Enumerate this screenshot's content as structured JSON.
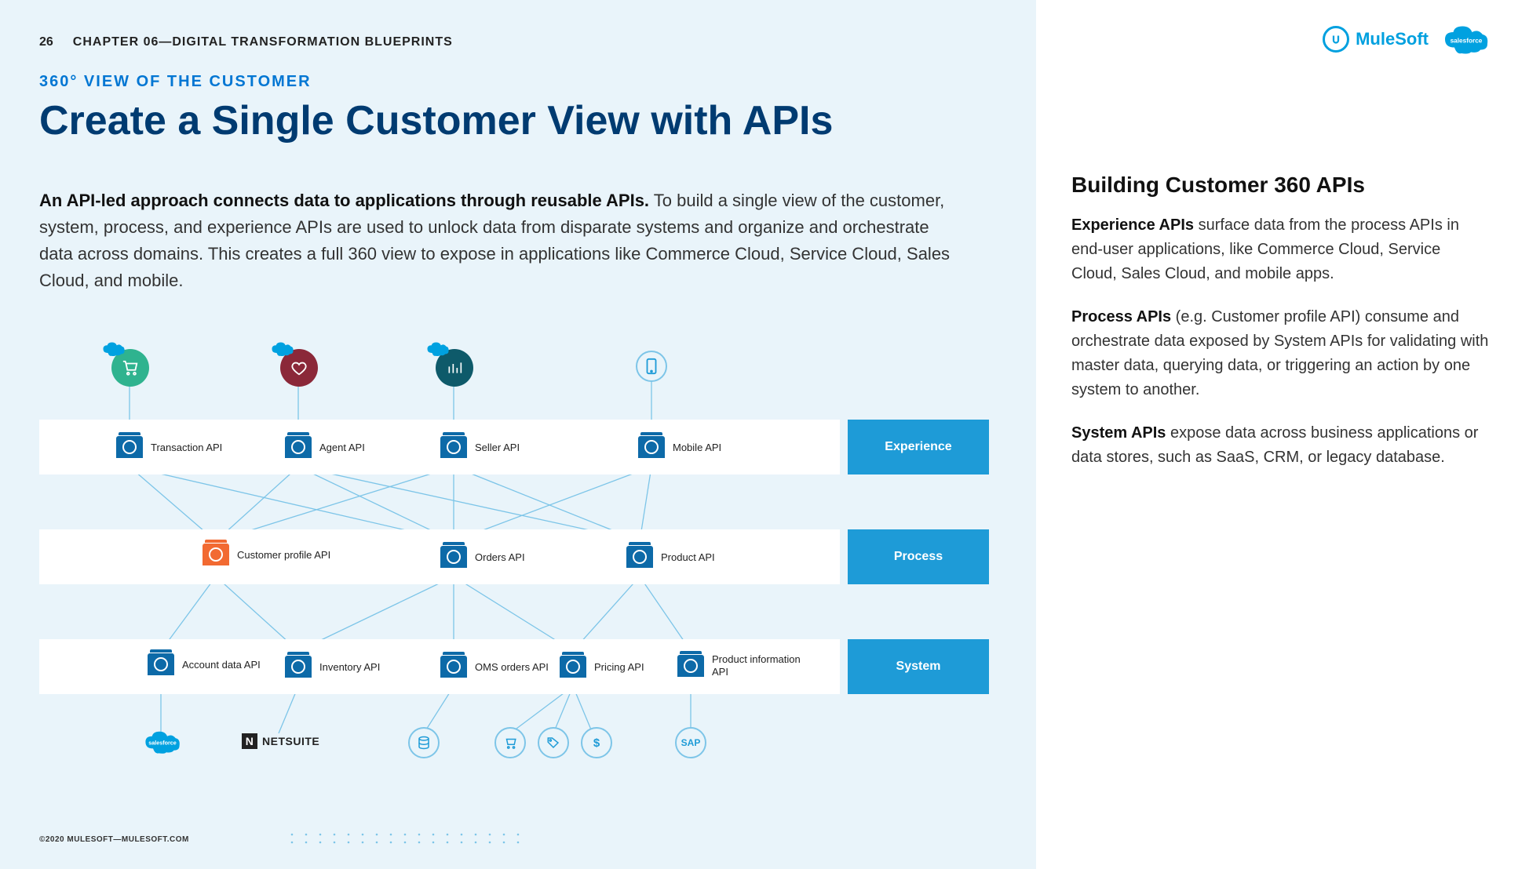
{
  "page_number": "26",
  "chapter_label": "CHAPTER 06—DIGITAL TRANSFORMATION BLUEPRINTS",
  "eyebrow": "360° VIEW OF THE CUSTOMER",
  "title": "Create a Single Customer View with APIs",
  "intro_bold": "An API-led approach connects data to applications through reusable APIs.",
  "intro_rest": " To build a single view of the customer, system, process, and experience APIs are used to unlock data from disparate systems and organize and orchestrate data across domains. This creates a full 360 view to expose in applications like Commerce Cloud, Service Cloud, Sales Cloud, and mobile.",
  "layers": {
    "experience": "Experience",
    "process": "Process",
    "system": "System"
  },
  "experience_apis": [
    "Transaction API",
    "Agent API",
    "Seller API",
    "Mobile API"
  ],
  "process_apis": [
    "Customer profile API",
    "Orders API",
    "Product API"
  ],
  "system_apis": [
    "Account data  API",
    "Inventory API",
    "OMS orders API",
    "Pricing API",
    "Product information API"
  ],
  "bottom_systems": {
    "salesforce": "salesforce",
    "netsuite": "NETSUITE",
    "sap": "SAP"
  },
  "top_clouds": {
    "commerce": "salesforce",
    "service": "salesforce",
    "sales": "salesforce"
  },
  "right": {
    "mulesoft": "MuleSoft",
    "sf": "salesforce",
    "heading": "Building Customer 360 APIs",
    "p1_bold": "Experience APIs",
    "p1_rest": " surface data from the process APIs in end-user applications, like Commerce Cloud, Service Cloud, Sales Cloud, and mobile apps.",
    "p2_bold": "Process APIs",
    "p2_rest": " (e.g. Customer profile API) consume and orchestrate data exposed by System APIs for validating with master data, querying data, or triggering an action by one system to another.",
    "p3_bold": "System APIs",
    "p3_rest": " expose data across business applications or data stores, such as SaaS, CRM, or legacy database."
  },
  "footer": "©2020 MULESOFT—MULESOFT.COM"
}
